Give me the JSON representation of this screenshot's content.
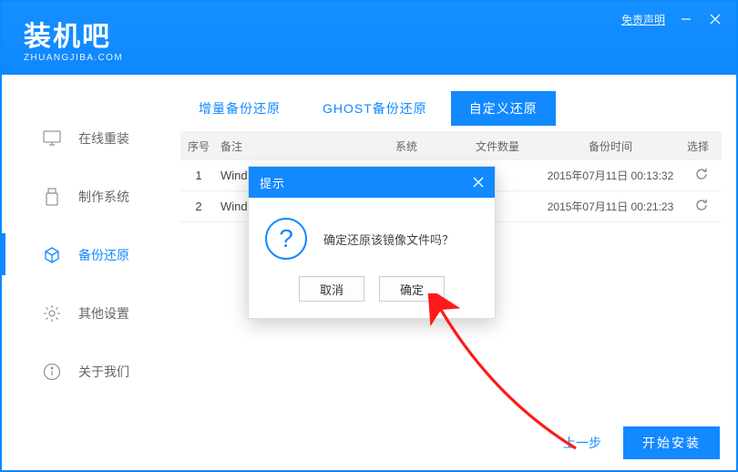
{
  "header": {
    "logo_text": "装机吧",
    "logo_sub": "ZHUANGJIBA.COM",
    "disclaimer": "免责声明"
  },
  "sidebar": {
    "items": [
      {
        "label": "在线重装"
      },
      {
        "label": "制作系统"
      },
      {
        "label": "备份还原"
      },
      {
        "label": "其他设置"
      },
      {
        "label": "关于我们"
      }
    ],
    "active_index": 2
  },
  "tabs": {
    "items": [
      {
        "label": "增量备份还原"
      },
      {
        "label": "GHOST备份还原"
      },
      {
        "label": "自定义还原"
      }
    ],
    "active_index": 2
  },
  "table": {
    "headers": {
      "id": "序号",
      "remark": "备注",
      "system": "系统",
      "count": "文件数量",
      "time": "备份时间",
      "select": "选择"
    },
    "rows": [
      {
        "id": "1",
        "remark": "Wind",
        "time": "2015年07月11日 00:13:32"
      },
      {
        "id": "2",
        "remark": "Wind",
        "time": "2015年07月11日 00:21:23"
      }
    ]
  },
  "modal": {
    "title": "提示",
    "message": "确定还原该镜像文件吗？",
    "cancel": "取消",
    "confirm": "确定",
    "indicator": "?"
  },
  "footer": {
    "prev": "上一步",
    "install": "开始安装"
  }
}
